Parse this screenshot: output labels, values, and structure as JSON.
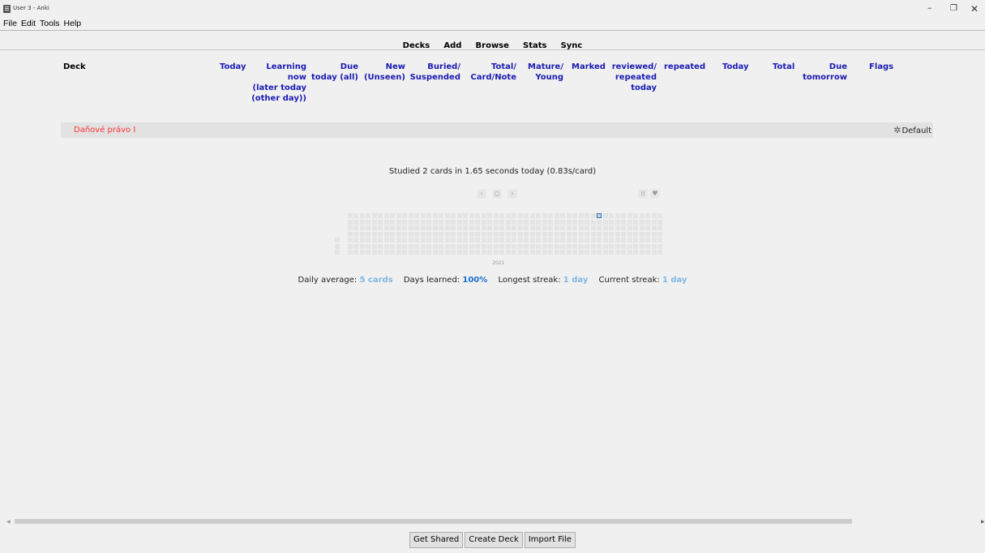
{
  "window": {
    "title": "User 3 - Anki",
    "controls": {
      "minimize": "–",
      "maximize": "❐",
      "close": "✕"
    }
  },
  "menu": [
    "File",
    "Edit",
    "Tools",
    "Help"
  ],
  "toolbar": [
    "Decks",
    "Add",
    "Browse",
    "Stats",
    "Sync"
  ],
  "columns": {
    "deck": "Deck",
    "today": "Today",
    "learning": [
      "Learning",
      "now",
      "(later today",
      "(other day))"
    ],
    "due": [
      "Due",
      "today (all)"
    ],
    "new": [
      "New",
      "(Unseen)"
    ],
    "buried": [
      "Buried/",
      "Suspended"
    ],
    "total": [
      "Total/",
      "Card/Note"
    ],
    "mature": [
      "Mature/",
      "Young"
    ],
    "marked": "Marked",
    "reviewed": [
      "reviewed/",
      "repeated",
      "today"
    ],
    "repeated": "repeated",
    "today2": "Today",
    "total2": "Total",
    "due_tomorrow": [
      "Due",
      "tomorrow"
    ],
    "flags": "Flags"
  },
  "decks": [
    {
      "name": "Daňové právo I",
      "options": "Default"
    }
  ],
  "stats": {
    "studied": "Studied 2 cards in 1.65 seconds today (0.83s/card)",
    "year": "2021",
    "nav": {
      "prev": "‹",
      "today": "○",
      "next": "›"
    },
    "daily_average_label": "Daily average:",
    "daily_average_value": "5 cards",
    "days_learned_label": "Days learned:",
    "days_learned_value": "100%",
    "longest_streak_label": "Longest streak:",
    "longest_streak_value": "1 day",
    "current_streak_label": "Current streak:",
    "current_streak_value": "1 day"
  },
  "bottom_buttons": [
    "Get Shared",
    "Create Deck",
    "Import File"
  ]
}
